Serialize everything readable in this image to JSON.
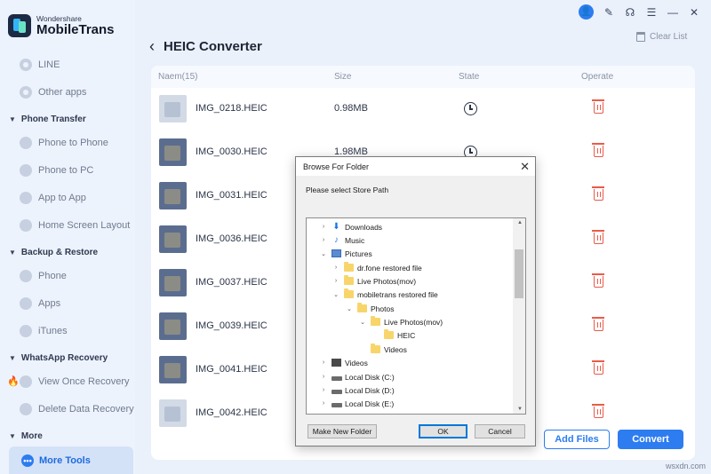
{
  "app": {
    "brand": "Wondershare",
    "name": "MobileTrans"
  },
  "sidebar": {
    "top_items": [
      {
        "label": "LINE"
      },
      {
        "label": "Other apps"
      }
    ],
    "sections": [
      {
        "title": "Phone Transfer",
        "items": [
          {
            "label": "Phone to Phone"
          },
          {
            "label": "Phone to PC"
          },
          {
            "label": "App to App"
          },
          {
            "label": "Home Screen Layout"
          }
        ]
      },
      {
        "title": "Backup & Restore",
        "items": [
          {
            "label": "Phone"
          },
          {
            "label": "Apps"
          },
          {
            "label": "iTunes"
          }
        ]
      },
      {
        "title": "WhatsApp Recovery",
        "items": [
          {
            "label": "View Once Recovery"
          },
          {
            "label": "Delete Data Recovery"
          }
        ]
      },
      {
        "title": "More",
        "items": [
          {
            "label": "More Tools",
            "active": true
          }
        ]
      }
    ]
  },
  "header": {
    "title": "HEIC Converter",
    "clear_label": "Clear List"
  },
  "table": {
    "columns": {
      "name": "Naem(15)",
      "size": "Size",
      "state": "State",
      "operate": "Operate"
    },
    "rows": [
      {
        "name": "IMG_0218.HEIC",
        "size": "0.98MB"
      },
      {
        "name": "IMG_0030.HEIC",
        "size": "1.98MB"
      },
      {
        "name": "IMG_0031.HEIC",
        "size": ""
      },
      {
        "name": "IMG_0036.HEIC",
        "size": ""
      },
      {
        "name": "IMG_0037.HEIC",
        "size": ""
      },
      {
        "name": "IMG_0039.HEIC",
        "size": ""
      },
      {
        "name": "IMG_0041.HEIC",
        "size": ""
      },
      {
        "name": "IMG_0042.HEIC",
        "size": ""
      }
    ]
  },
  "actions": {
    "add_files": "Add Files",
    "convert": "Convert"
  },
  "dialog": {
    "title": "Browse For Folder",
    "prompt": "Please select Store Path",
    "tree": [
      {
        "label": "Downloads"
      },
      {
        "label": "Music"
      },
      {
        "label": "Pictures"
      },
      {
        "label": "dr.fone restored file"
      },
      {
        "label": "Live Photos(mov)"
      },
      {
        "label": "mobiletrans restored file"
      },
      {
        "label": "Photos"
      },
      {
        "label": "Live Photos(mov)"
      },
      {
        "label": "HEIC"
      },
      {
        "label": "Videos"
      },
      {
        "label": "Videos"
      },
      {
        "label": "Local Disk (C:)"
      },
      {
        "label": "Local Disk (D:)"
      },
      {
        "label": "Local Disk (E:)"
      }
    ],
    "make_folder": "Make New Folder",
    "ok": "OK",
    "cancel": "Cancel"
  },
  "watermark": "wsxdn.com"
}
